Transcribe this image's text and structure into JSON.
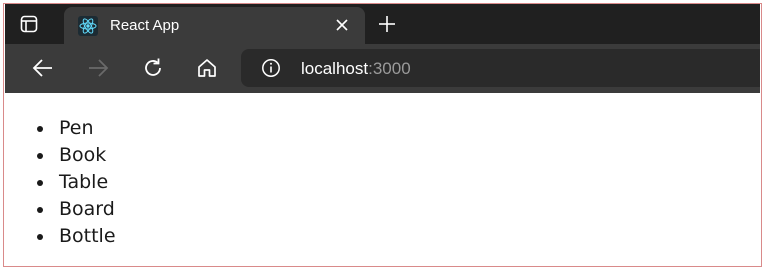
{
  "browser": {
    "tab": {
      "title": "React App",
      "favicon": "react-logo-icon"
    },
    "address": {
      "host": "localhost",
      "port": ":3000"
    },
    "icons": {
      "tab_actions": "tab-actions-icon",
      "close": "close-icon",
      "new_tab": "plus-icon",
      "back": "back-arrow-icon",
      "forward": "forward-arrow-icon",
      "refresh": "refresh-icon",
      "home": "home-icon",
      "site_info": "info-icon"
    },
    "colors": {
      "tabstrip_bg": "#202020",
      "toolbar_bg": "#3b3b3b",
      "address_bg": "#2a2a2a",
      "react_blue": "#61dafb"
    }
  },
  "page": {
    "items": [
      "Pen",
      "Book",
      "Table",
      "Board",
      "Bottle"
    ]
  }
}
